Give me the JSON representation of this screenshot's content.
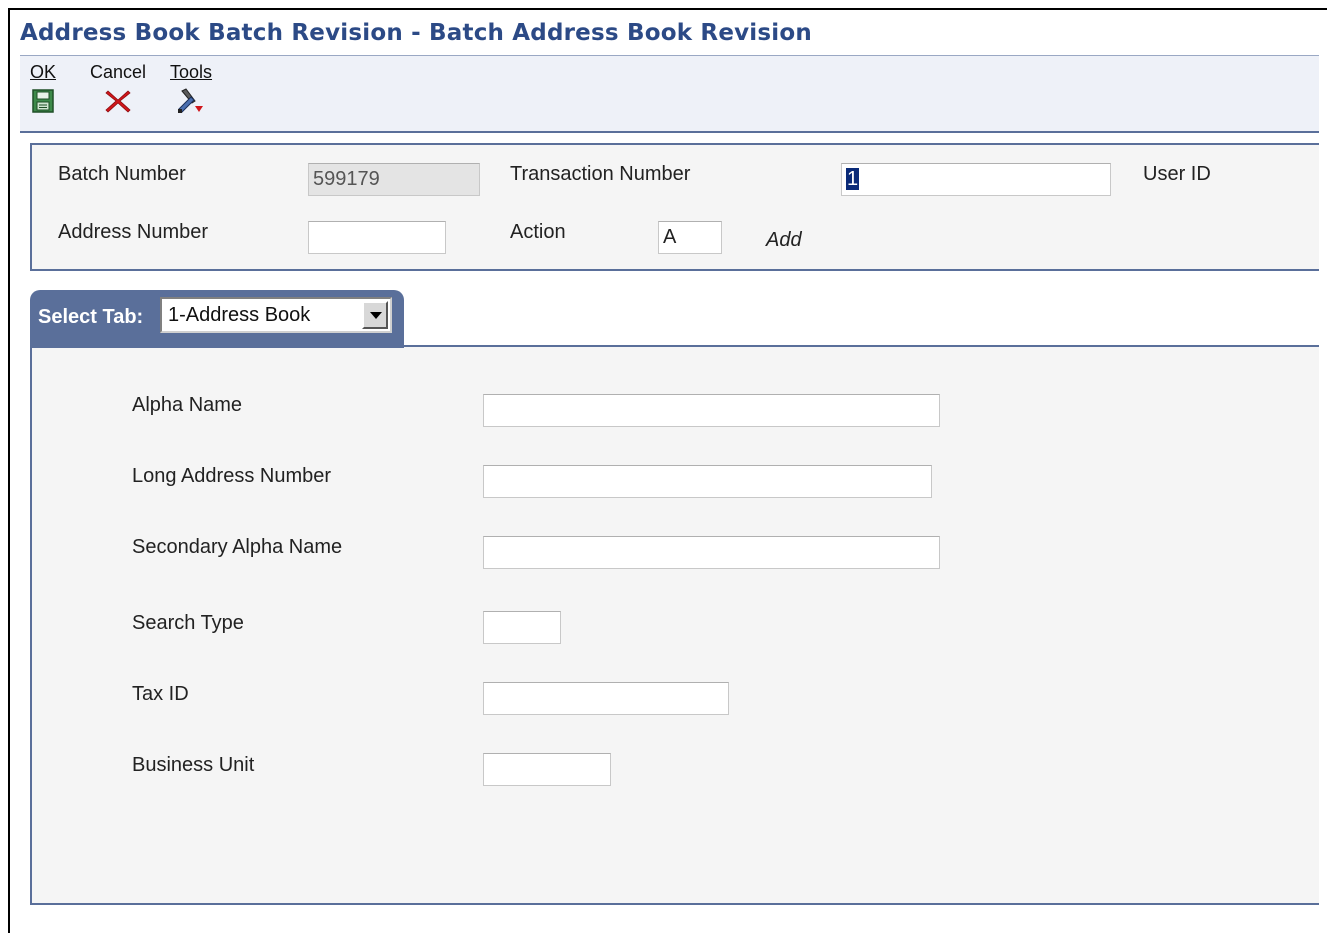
{
  "window": {
    "title": "Address Book Batch Revision - Batch Address Book Revision"
  },
  "toolbar": {
    "ok": {
      "label_prefix": "O",
      "label_underlined": "",
      "label": "OK",
      "icon": "save-disk-icon"
    },
    "cancel": {
      "label": "Cancel",
      "icon": "red-x-icon"
    },
    "tools": {
      "label": "Tools",
      "icon": "tools-icon"
    }
  },
  "header": {
    "batch_number": {
      "label": "Batch Number",
      "value": "599179"
    },
    "transaction_number": {
      "label": "Transaction Number",
      "value": "1"
    },
    "user_id": {
      "label": "User ID",
      "value": ""
    },
    "address_number": {
      "label": "Address Number",
      "value": ""
    },
    "action": {
      "label": "Action",
      "value": "A",
      "description": "Add"
    }
  },
  "tab": {
    "select_label": "Select Tab:",
    "selected": "1-Address Book"
  },
  "form": {
    "alpha_name": {
      "label": "Alpha Name",
      "value": ""
    },
    "long_address_number": {
      "label": "Long Address Number",
      "value": ""
    },
    "secondary_alpha_name": {
      "label": "Secondary Alpha Name",
      "value": ""
    },
    "search_type": {
      "label": "Search Type",
      "value": ""
    },
    "tax_id": {
      "label": "Tax ID",
      "value": ""
    },
    "business_unit": {
      "label": "Business Unit",
      "value": ""
    }
  },
  "colors": {
    "title": "#2c4a86",
    "tab_header": "#5a6f9a",
    "toolbar_bg": "#eef1f8",
    "selection": "#0a2a78"
  }
}
